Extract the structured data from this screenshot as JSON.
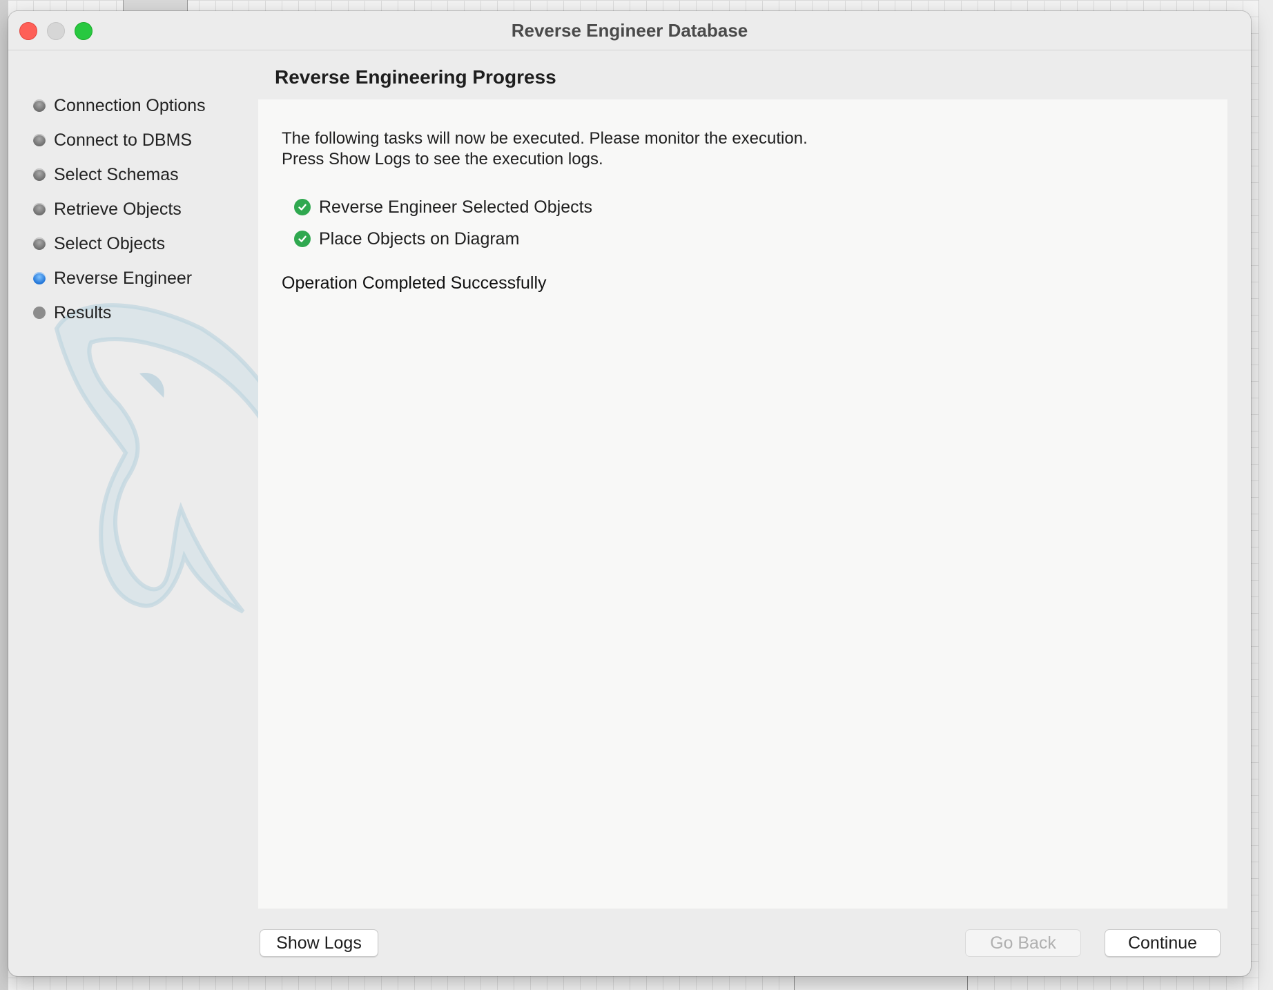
{
  "window": {
    "title": "Reverse Engineer Database"
  },
  "sidebar": {
    "steps": [
      {
        "label": "Connection Options",
        "state": "done"
      },
      {
        "label": "Connect to DBMS",
        "state": "done"
      },
      {
        "label": "Select Schemas",
        "state": "done"
      },
      {
        "label": "Retrieve Objects",
        "state": "done"
      },
      {
        "label": "Select Objects",
        "state": "done"
      },
      {
        "label": "Reverse Engineer",
        "state": "active"
      },
      {
        "label": "Results",
        "state": "pending"
      }
    ]
  },
  "main": {
    "title": "Reverse Engineering Progress",
    "intro_line1": "The following tasks will now be executed. Please monitor the execution.",
    "intro_line2": "Press Show Logs to see the execution logs.",
    "tasks": [
      {
        "label": "Reverse Engineer Selected Objects",
        "status": "completed"
      },
      {
        "label": "Place Objects on Diagram",
        "status": "completed"
      }
    ],
    "status_message": "Operation Completed Successfully"
  },
  "footer": {
    "show_logs_label": "Show Logs",
    "go_back_label": "Go Back",
    "continue_label": "Continue"
  },
  "colors": {
    "accent_active": "#1f73d6",
    "check_success": "#2fa84f",
    "close_button": "#fe5f57",
    "maximize_button": "#28c840"
  },
  "icons": {
    "step_marker": "step-dot-icon",
    "task_done": "check-circle-icon",
    "watermark": "dolphin-logo"
  }
}
